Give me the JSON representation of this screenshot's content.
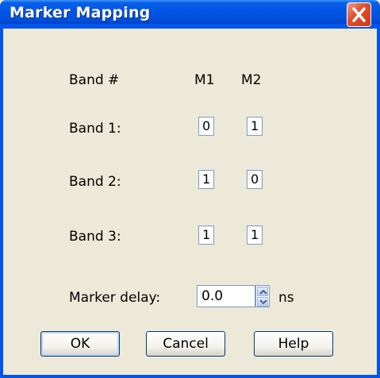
{
  "window": {
    "title": "Marker Mapping"
  },
  "header": {
    "band_label": "Band #",
    "m1": "M1",
    "m2": "M2"
  },
  "bands": [
    {
      "label": "Band 1:",
      "m1": "0",
      "m2": "1"
    },
    {
      "label": "Band 2:",
      "m1": "1",
      "m2": "0"
    },
    {
      "label": "Band 3:",
      "m1": "1",
      "m2": "1"
    }
  ],
  "delay": {
    "label": "Marker delay:",
    "value": "0.0",
    "unit": "ns"
  },
  "buttons": {
    "ok": "OK",
    "cancel": "Cancel",
    "help": "Help"
  }
}
